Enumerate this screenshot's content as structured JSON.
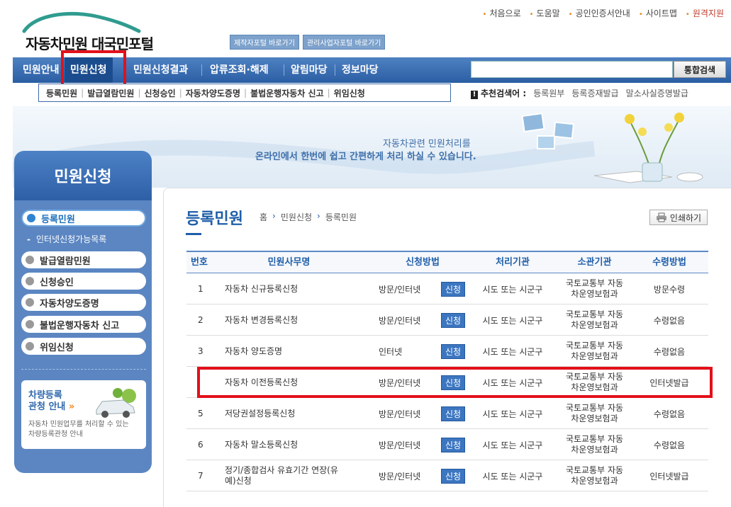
{
  "top_links": [
    "처음으로",
    "도움말",
    "공인인증서안내",
    "사이트맵",
    "원격지원"
  ],
  "logo": {
    "text": "자동차민원 대국민포털"
  },
  "portal_buttons": [
    "제작자포털 바로가기",
    "관리사업자포털 바로가기"
  ],
  "nav": {
    "items": [
      "민원안내",
      "민원신청",
      "민원신청결과",
      "압류조회·해제",
      "알림마당",
      "정보마당"
    ],
    "search_placeholder": "",
    "search_button": "통합검색"
  },
  "sub_nav": [
    "등록민원",
    "발급열람민원",
    "신청승인",
    "자동차양도증명",
    "불법운행자동차 신고",
    "위임신청"
  ],
  "recommended": {
    "label": "추천검색어 :",
    "terms": [
      "등록원부",
      "등록증재발급",
      "말소사실증명발급"
    ]
  },
  "banner": {
    "line1": "자동차관련 민원처리를",
    "line2": "온라인에서 한번에 쉽고 간편하게 처리 하실 수 있습니다."
  },
  "side": {
    "title": "민원신청",
    "menu": [
      "등록민원",
      "발급열람민원",
      "신청승인",
      "자동차양도증명",
      "불법운행자동차 신고",
      "위임신청"
    ],
    "sub_item": "인터넷신청가능목록",
    "promo_title_1": "차량등록",
    "promo_title_2": "관청 안내",
    "promo_arrow": "»",
    "promo_desc_1": "자동차 민원업무를 처리할 수 있는",
    "promo_desc_2": "차량등록관청 안내"
  },
  "page": {
    "title": "등록민원",
    "breadcrumb": [
      "홈",
      "민원신청",
      "등록민원"
    ],
    "print_button": "인쇄하기"
  },
  "table": {
    "headers": [
      "번호",
      "민원사무명",
      "신청방법",
      "처리기관",
      "소관기관",
      "수령방법"
    ],
    "apply_label": "신청",
    "rows": [
      {
        "no": "1",
        "name": "자동차 신규등록신청",
        "method": "방문/인터넷",
        "handler": "시도 또는 시군구",
        "agency_1": "국토교통부 자동",
        "agency_2": "차운영보험과",
        "receive": "방문수령"
      },
      {
        "no": "2",
        "name": "자동차 변경등록신청",
        "method": "방문/인터넷",
        "handler": "시도 또는 시군구",
        "agency_1": "국토교통부 자동",
        "agency_2": "차운영보험과",
        "receive": "수령없음"
      },
      {
        "no": "3",
        "name": "자동차 양도증명",
        "method": "인터넷",
        "handler": "시도 또는 시군구",
        "agency_1": "국토교통부 자동",
        "agency_2": "차운영보험과",
        "receive": "수령없음"
      },
      {
        "no": "",
        "name": "자동차 이전등록신청",
        "method": "방문/인터넷",
        "handler": "시도 또는 시군구",
        "agency_1": "국토교통부 자동",
        "agency_2": "차운영보험과",
        "receive": "인터넷발급"
      },
      {
        "no": "5",
        "name": "저당권설정등록신청",
        "method": "방문/인터넷",
        "handler": "시도 또는 시군구",
        "agency_1": "국토교통부 자동",
        "agency_2": "차운영보험과",
        "receive": "수령없음"
      },
      {
        "no": "6",
        "name": "자동차 말소등록신청",
        "method": "방문/인터넷",
        "handler": "시도 또는 시군구",
        "agency_1": "국토교통부 자동",
        "agency_2": "차운영보험과",
        "receive": "수령없음"
      },
      {
        "no": "7",
        "name": "정기/종합검사 유효기간 연장(유",
        "name_2": "예)신청",
        "method": "방문/인터넷",
        "handler": "시도 또는 시군구",
        "agency_1": "국토교통부 자동",
        "agency_2": "차운영보험과",
        "receive": "인터넷발급"
      }
    ]
  },
  "colors": {
    "nav_blue": "#2a5ea3",
    "accent_blue": "#1f5ea8",
    "highlight_red": "#e3101a"
  }
}
